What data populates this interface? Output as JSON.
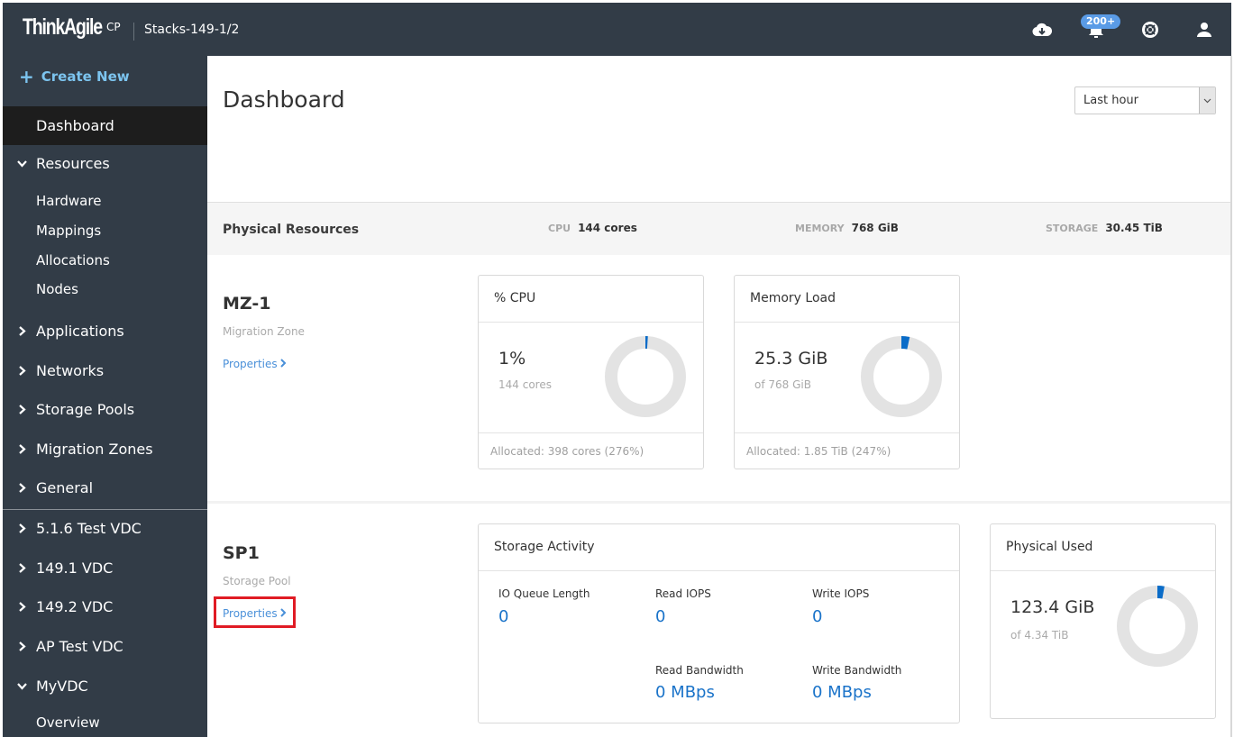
{
  "topbar": {
    "logo": "ThinkAgile",
    "logo_suffix": "CP",
    "stack_name": "Stacks-149-1/2",
    "notification_badge": "200+",
    "icons": [
      "cloud-download-icon",
      "bell-icon",
      "lifebuoy-help-icon",
      "user-icon"
    ]
  },
  "sidebar": {
    "create_new": "Create New",
    "active": "Dashboard",
    "items": [
      {
        "label": "Dashboard",
        "expanded": null
      },
      {
        "label": "Resources",
        "expanded": true,
        "children": [
          "Hardware",
          "Mappings",
          "Allocations",
          "Nodes"
        ]
      },
      {
        "label": "Applications",
        "expanded": false
      },
      {
        "label": "Networks",
        "expanded": false
      },
      {
        "label": "Storage Pools",
        "expanded": false
      },
      {
        "label": "Migration Zones",
        "expanded": false
      },
      {
        "label": "General",
        "expanded": false
      }
    ],
    "vdcs": [
      {
        "label": "5.1.6 Test VDC",
        "expanded": false
      },
      {
        "label": "149.1 VDC",
        "expanded": false
      },
      {
        "label": "149.2 VDC",
        "expanded": false
      },
      {
        "label": "AP Test VDC",
        "expanded": false
      },
      {
        "label": "MyVDC",
        "expanded": true,
        "children": [
          "Overview"
        ]
      }
    ]
  },
  "main": {
    "title": "Dashboard",
    "time_range": {
      "selected": "Last hour"
    },
    "physical_resources": {
      "title": "Physical Resources",
      "cpu_label": "CPU",
      "cpu_value": "144 cores",
      "memory_label": "MEMORY",
      "memory_value": "768 GiB",
      "storage_label": "STORAGE",
      "storage_value": "30.45 TiB"
    },
    "migration_zone": {
      "name": "MZ-1",
      "type": "Migration Zone",
      "properties_link": "Properties",
      "cpu_card": {
        "title": "% CPU",
        "value": "1%",
        "sub": "144 cores",
        "footer": "Allocated: 398 cores (276%)",
        "fraction": 0.01
      },
      "memory_card": {
        "title": "Memory Load",
        "value": "25.3 GiB",
        "sub": "of 768 GiB",
        "footer": "Allocated: 1.85 TiB (247%)",
        "fraction": 0.033
      }
    },
    "storage_pool": {
      "name": "SP1",
      "type": "Storage Pool",
      "properties_link": "Properties",
      "activity_card": {
        "title": "Storage Activity",
        "metrics": [
          {
            "label": "IO Queue Length",
            "value": "0"
          },
          {
            "label": "Read IOPS",
            "value": "0"
          },
          {
            "label": "Write IOPS",
            "value": "0"
          },
          {
            "label": "Read Bandwidth",
            "value": "0 MBps"
          },
          {
            "label": "Write Bandwidth",
            "value": "0 MBps"
          }
        ]
      },
      "physical_used_card": {
        "title": "Physical Used",
        "value": "123.4 GiB",
        "sub": "of 4.34 TiB",
        "fraction": 0.028
      }
    }
  },
  "colors": {
    "nav_bg": "#323c47",
    "active_bg": "#1d1d1d",
    "accent": "#1a73c9",
    "link": "#4a90d9",
    "create_new": "#7cc4ef",
    "badge": "#5a9be6",
    "donut_track": "#e3e3e3",
    "donut_fill": "#0a6cc8",
    "highlight": "#e01b24"
  }
}
